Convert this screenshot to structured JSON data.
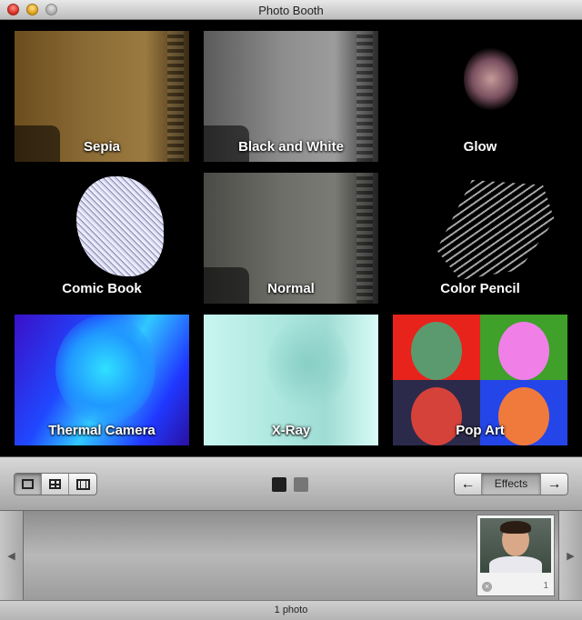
{
  "window": {
    "title": "Photo Booth"
  },
  "effects": [
    {
      "label": "Sepia"
    },
    {
      "label": "Black and White"
    },
    {
      "label": "Glow"
    },
    {
      "label": "Comic Book"
    },
    {
      "label": "Normal"
    },
    {
      "label": "Color Pencil"
    },
    {
      "label": "Thermal Camera"
    },
    {
      "label": "X-Ray"
    },
    {
      "label": "Pop Art"
    }
  ],
  "toolbar": {
    "effects_label": "Effects",
    "prev_arrow": "←",
    "next_arrow": "→",
    "view_modes": [
      "single-photo",
      "four-up",
      "movie-clip"
    ],
    "active_view_mode": "single-photo"
  },
  "tray": {
    "left_arrow": "◀",
    "right_arrow": "▶",
    "thumbnails": [
      {
        "number": "1",
        "delete_glyph": "×"
      }
    ]
  },
  "status": {
    "text": "1 photo"
  }
}
